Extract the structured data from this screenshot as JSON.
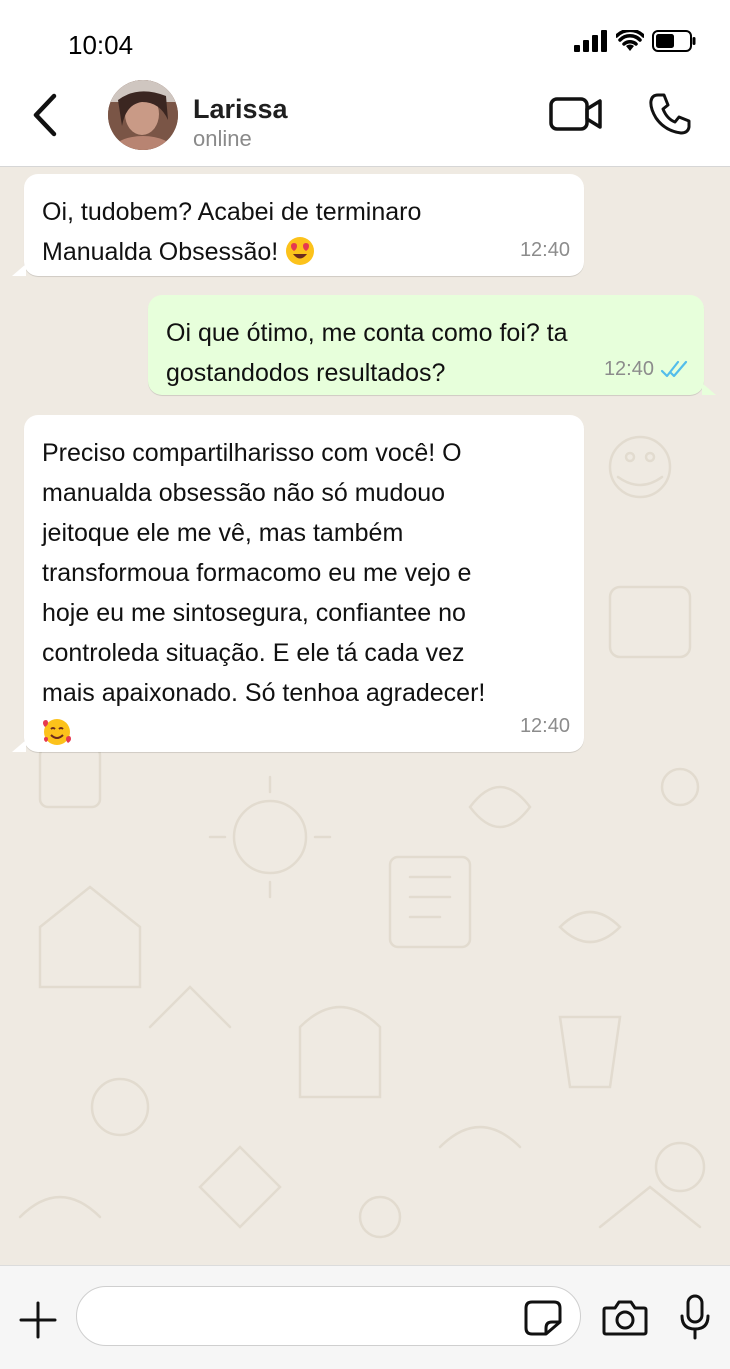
{
  "status_bar": {
    "time": "10:04"
  },
  "header": {
    "contact_name": "Larissa",
    "contact_status": "online",
    "back_icon": "chevron-left-icon",
    "video_icon": "video-camera-icon",
    "call_icon": "phone-icon"
  },
  "messages": [
    {
      "direction": "incoming",
      "text": "Oi, tudobem? Acabei de terminaro\nManualda Obsessão! ",
      "emoji": "smiling-face-with-heart-eyes-icon",
      "time": "12:40"
    },
    {
      "direction": "outgoing",
      "text": "Oi que ótimo, me conta como foi? ta\ngostandodos resultados?",
      "time": "12:40",
      "status_icon": "double-check-icon"
    },
    {
      "direction": "incoming",
      "text": "Preciso compartilharisso com você! O\nmanualda obsessão não só mudouo\njeitoque ele me vê, mas também\ntransformoua formacomo eu me vejo e\nhoje eu me sintosegura, confiantee no\ncontroleda situação. E ele tá cada vez\nmais apaixonado. Só tenhoa agradecer!",
      "emoji": "smiling-face-with-hearts-icon",
      "time": "12:40"
    }
  ],
  "input_bar": {
    "placeholder": "",
    "plus_icon": "plus-icon",
    "sticker_icon": "sticker-icon",
    "camera_icon": "camera-icon",
    "mic_icon": "microphone-icon"
  },
  "colors": {
    "chat_background": "#efeae2",
    "incoming_bubble": "#ffffff",
    "outgoing_bubble": "#e7ffdb",
    "read_check": "#53bdeb"
  }
}
